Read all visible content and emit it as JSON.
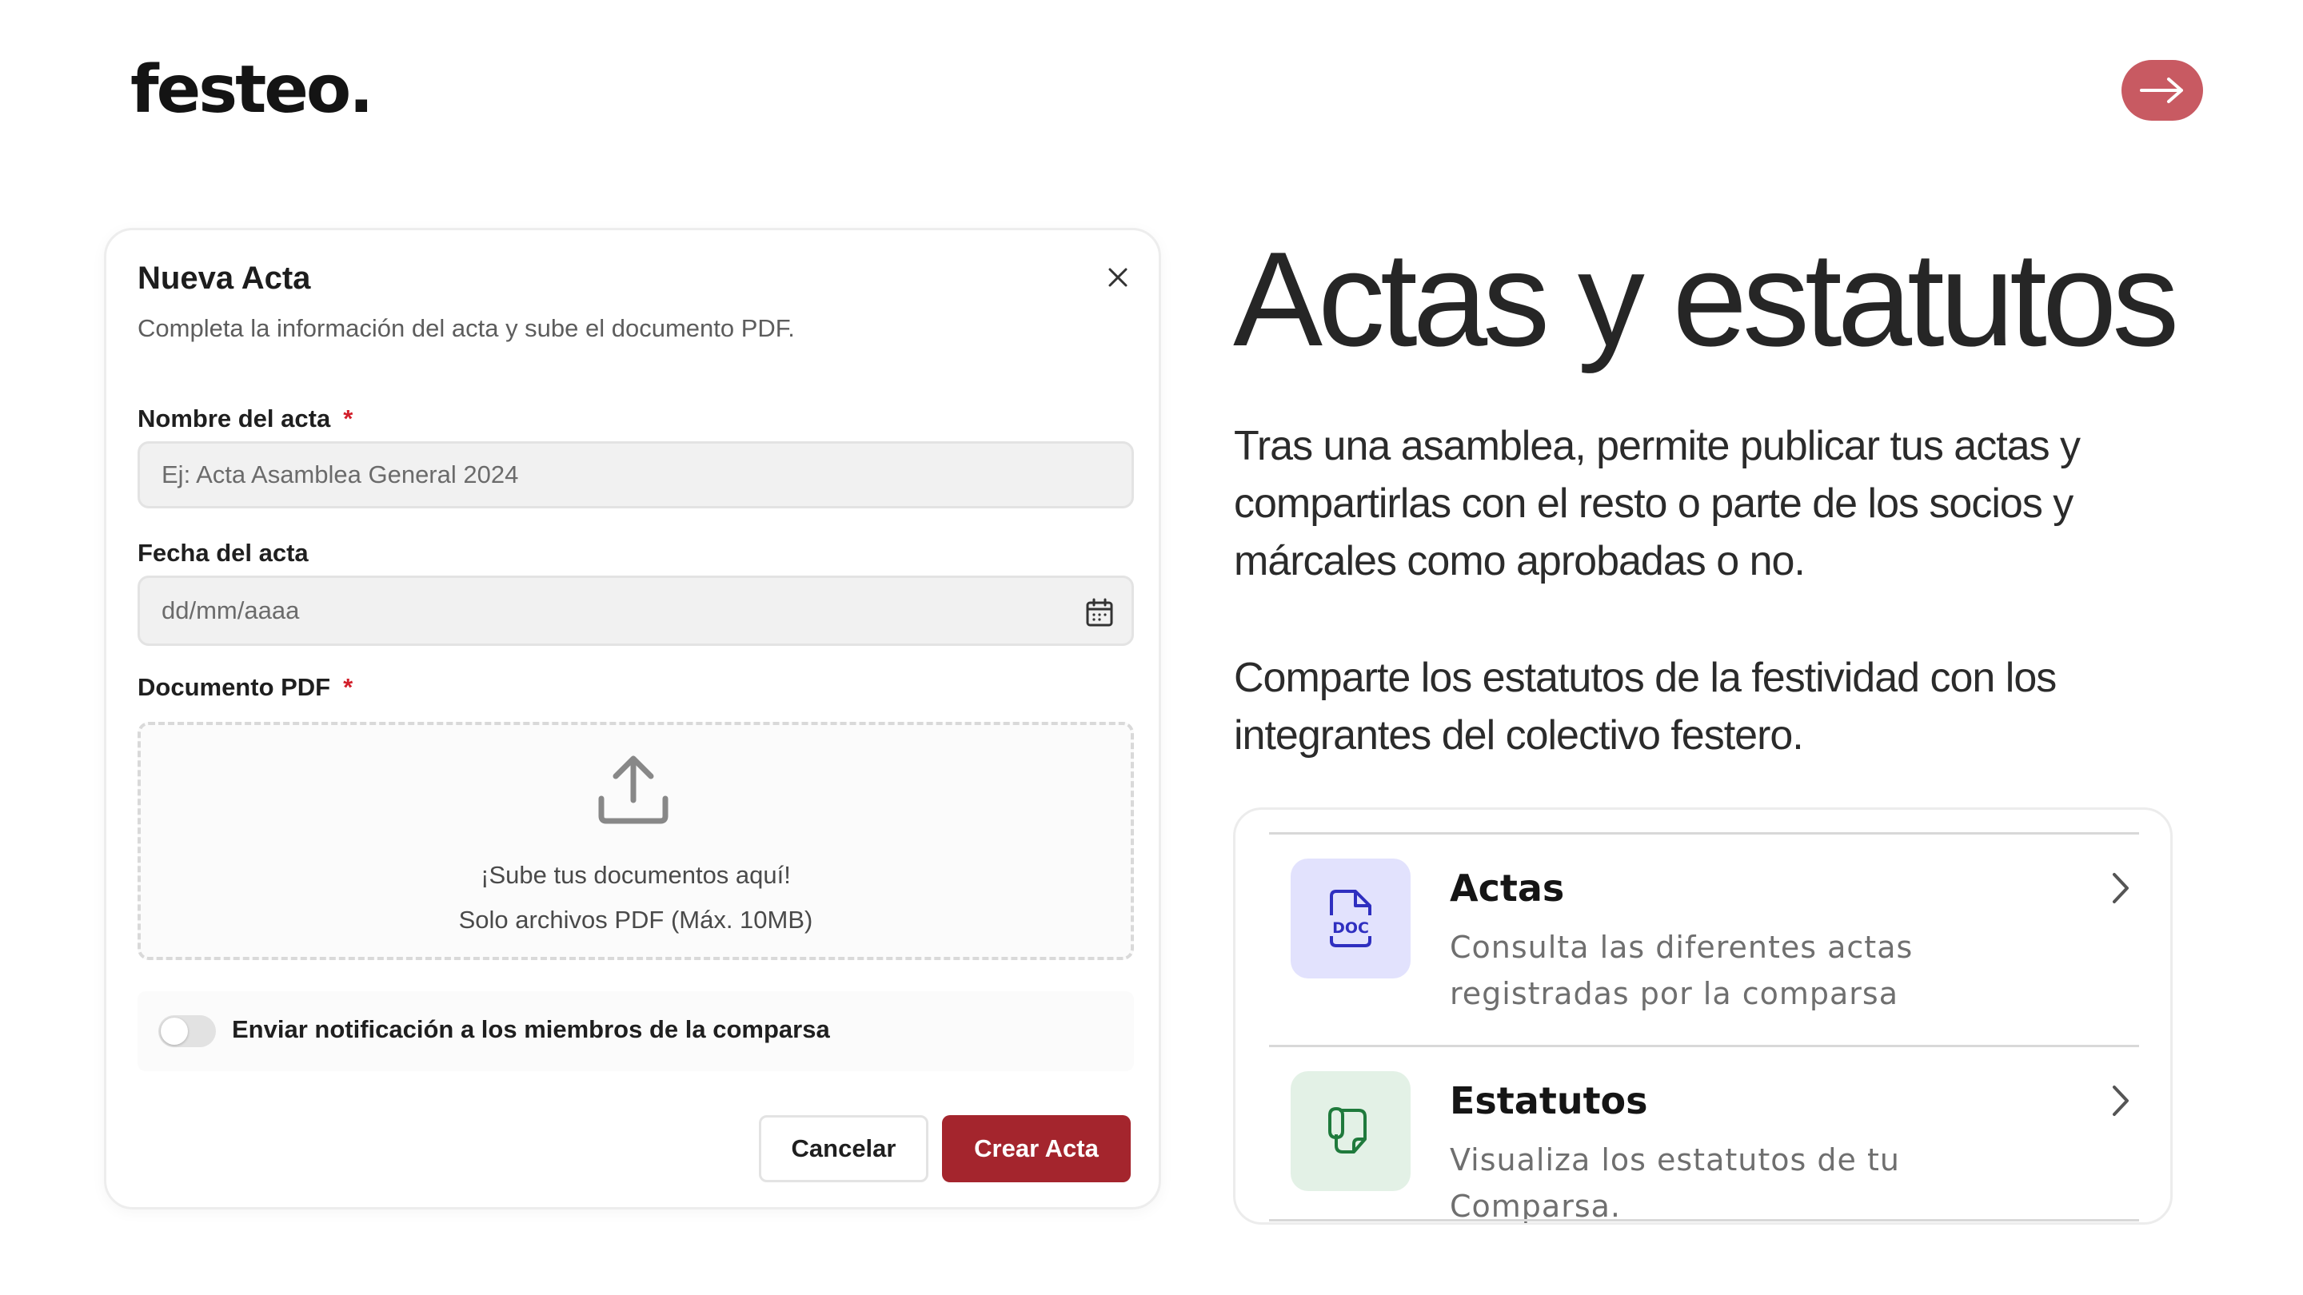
{
  "brand": {
    "logo_text": "festeo."
  },
  "nav": {
    "next_icon": "arrow-right-icon",
    "accent_color": "#c85a62"
  },
  "modal": {
    "title": "Nueva Acta",
    "subtitle": "Completa la información del acta y sube el documento PDF.",
    "close_icon": "close-icon",
    "name_field": {
      "label": "Nombre del acta",
      "required_mark": "*",
      "placeholder": "Ej: Acta Asamblea General 2024",
      "value": ""
    },
    "date_field": {
      "label": "Fecha del acta",
      "placeholder": "dd/mm/aaaa",
      "value": "",
      "icon": "calendar-icon"
    },
    "pdf_field": {
      "label": "Documento PDF",
      "required_mark": "*",
      "dropzone_title": "¡Sube tus documentos aquí!",
      "dropzone_hint": "Solo archivos PDF (Máx. 10MB)",
      "icon": "upload-icon"
    },
    "notify": {
      "label": "Enviar notificación a los miembros de la comparsa",
      "enabled": false
    },
    "cancel_label": "Cancelar",
    "create_label": "Crear Acta",
    "primary_color": "#a4252d"
  },
  "hero": {
    "heading": "Actas y estatutos",
    "paragraph_1": "Tras una asamblea, permite publicar tus actas y compartirlas con el resto o parte de los socios y márcales como aprobadas o no.",
    "paragraph_2": "Comparte los estatutos de la festividad con los integrantes del colectivo festero."
  },
  "features": [
    {
      "title": "Actas",
      "description": "Consulta las diferentes actas registradas por la comparsa",
      "icon": "doc-file-icon",
      "icon_bg": "#e2e2fd",
      "icon_color": "#2f2fc0"
    },
    {
      "title": "Estatutos",
      "description": "Visualiza los estatutos de tu Comparsa.",
      "icon": "attachment-file-icon",
      "icon_bg": "#e3f1e6",
      "icon_color": "#1f7a3c"
    }
  ]
}
